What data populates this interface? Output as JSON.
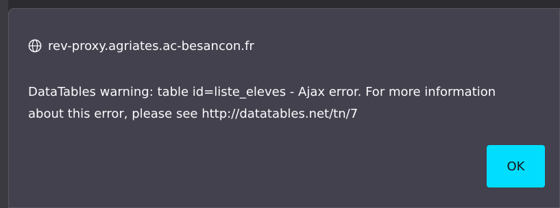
{
  "dialog": {
    "origin": "rev-proxy.agriates.ac-besancon.fr",
    "origin_icon": "globe-icon",
    "message": "DataTables warning: table id=liste_eleves - Ajax error. For more information about this error, please see http://datatables.net/tn/7",
    "ok_label": "OK"
  },
  "colors": {
    "dialog_background": "#42414d",
    "page_background": "#2c2b30",
    "text": "#fbfbfe",
    "button_background": "#00ddff",
    "button_text": "#15141a"
  }
}
